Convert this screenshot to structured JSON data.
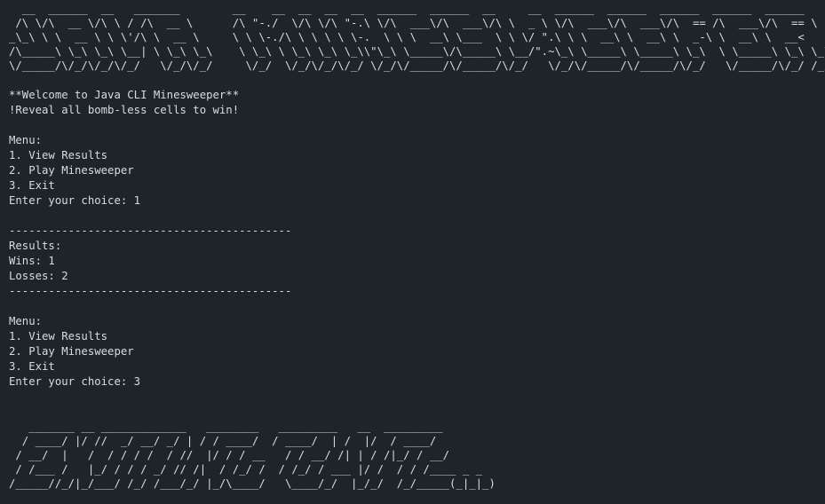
{
  "banner": [
    "  __  ______  __   _______        __    __  __  __  __  ______  ______  __     __  ______  ______  ______  ______  ______",
    " /\\ \\/\\  __ \\/\\ \\ / /\\  __ \\      /\\ \"-./  \\/\\ \\/\\ \"-.\\ \\/\\  ___\\/\\  ___\\/\\ \\  _ \\ \\/\\  ___\\/\\  ___\\/\\  == /\\  ___\\/\\  == \\",
    "_\\_\\ \\ \\  __ \\ \\ \\'/\\ \\  __ \\     \\ \\ \\-./\\ \\ \\ \\ \\ \\-.  \\ \\ \\  __\\ \\___  \\ \\ \\/ \".\\ \\ \\  __\\ \\  __\\ \\  _-\\ \\  __\\ \\  __<",
    "/\\_____\\ \\_\\ \\_\\ \\__| \\ \\_\\ \\_\\    \\ \\_\\ \\ \\_\\ \\_\\ \\_\\\\\"\\_\\ \\_____\\/\\_____\\ \\__/\".~\\_\\ \\_____\\ \\_____\\ \\_\\  \\ \\_____\\ \\_\\ \\_\\",
    "\\/_____/\\/_/\\/_/\\/_/   \\/_/\\/_/     \\/_/  \\/_/\\/_/\\/_/ \\/_/\\/_____/\\/_____/\\/_/   \\/_/\\/_____/\\/_____/\\/_/   \\/_____/\\/_/ /_/"
  ],
  "welcome": {
    "title": "**Welcome to Java CLI Minesweeper**",
    "subtitle": "!Reveal all bomb-less cells to win!"
  },
  "menu_first": {
    "heading": "Menu:",
    "options": [
      "1. View Results",
      "2. Play Minesweeper",
      "3. Exit"
    ],
    "prompt": "Enter your choice: 1"
  },
  "results": {
    "divider_top": "-------------------------------------------",
    "heading": "Results:",
    "wins": "Wins: 1",
    "losses": "Losses: 2",
    "divider_bottom": "-------------------------------------------"
  },
  "menu_second": {
    "heading": "Menu:",
    "options": [
      "1. View Results",
      "2. Play Minesweeper",
      "3. Exit"
    ],
    "prompt": "Enter your choice: 3"
  },
  "footer": [
    "   _______ __ _____________   ________   _________   __  _________",
    "  / ____/ |/ //  _/ __/ _/ | / / ____/  / ____/  | /  |/  / ____/",
    " / __/  |   /  / / / /  / //  |/ / / __   / / __/ /| | / /|_/ / __/",
    " / /___ /   |_/ / / / _/ // /|  / /_/ /  / /_/ / ___ |/ /  / / /____ _ _",
    "/_____//_/|_/___/ /_/ /___/_/ |_/\\____/   \\____/_/  |_/_/  /_/_____(_|_|_)"
  ]
}
